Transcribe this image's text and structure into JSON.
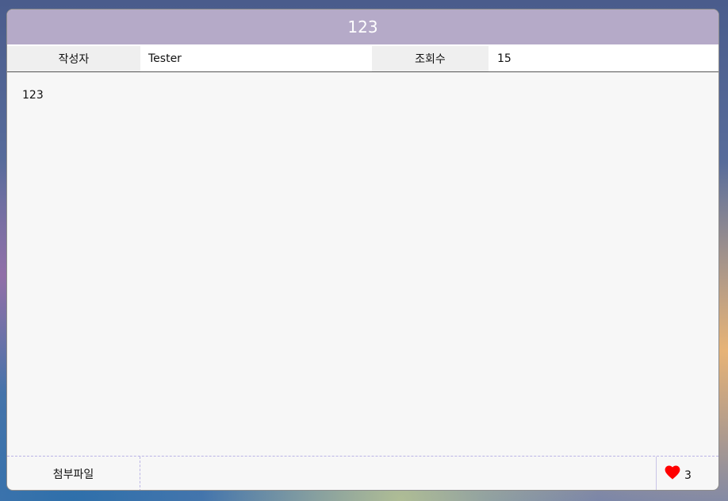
{
  "post": {
    "title": "123",
    "author_label": "작성자",
    "author": "Tester",
    "views_label": "조회수",
    "views": "15",
    "content": "123"
  },
  "footer": {
    "attachment_label": "첨부파일",
    "like_count": "3"
  },
  "colors": {
    "title_bar": "#b5aac8",
    "heart": "#ff0000"
  },
  "icons": {
    "like": "heart-icon"
  }
}
